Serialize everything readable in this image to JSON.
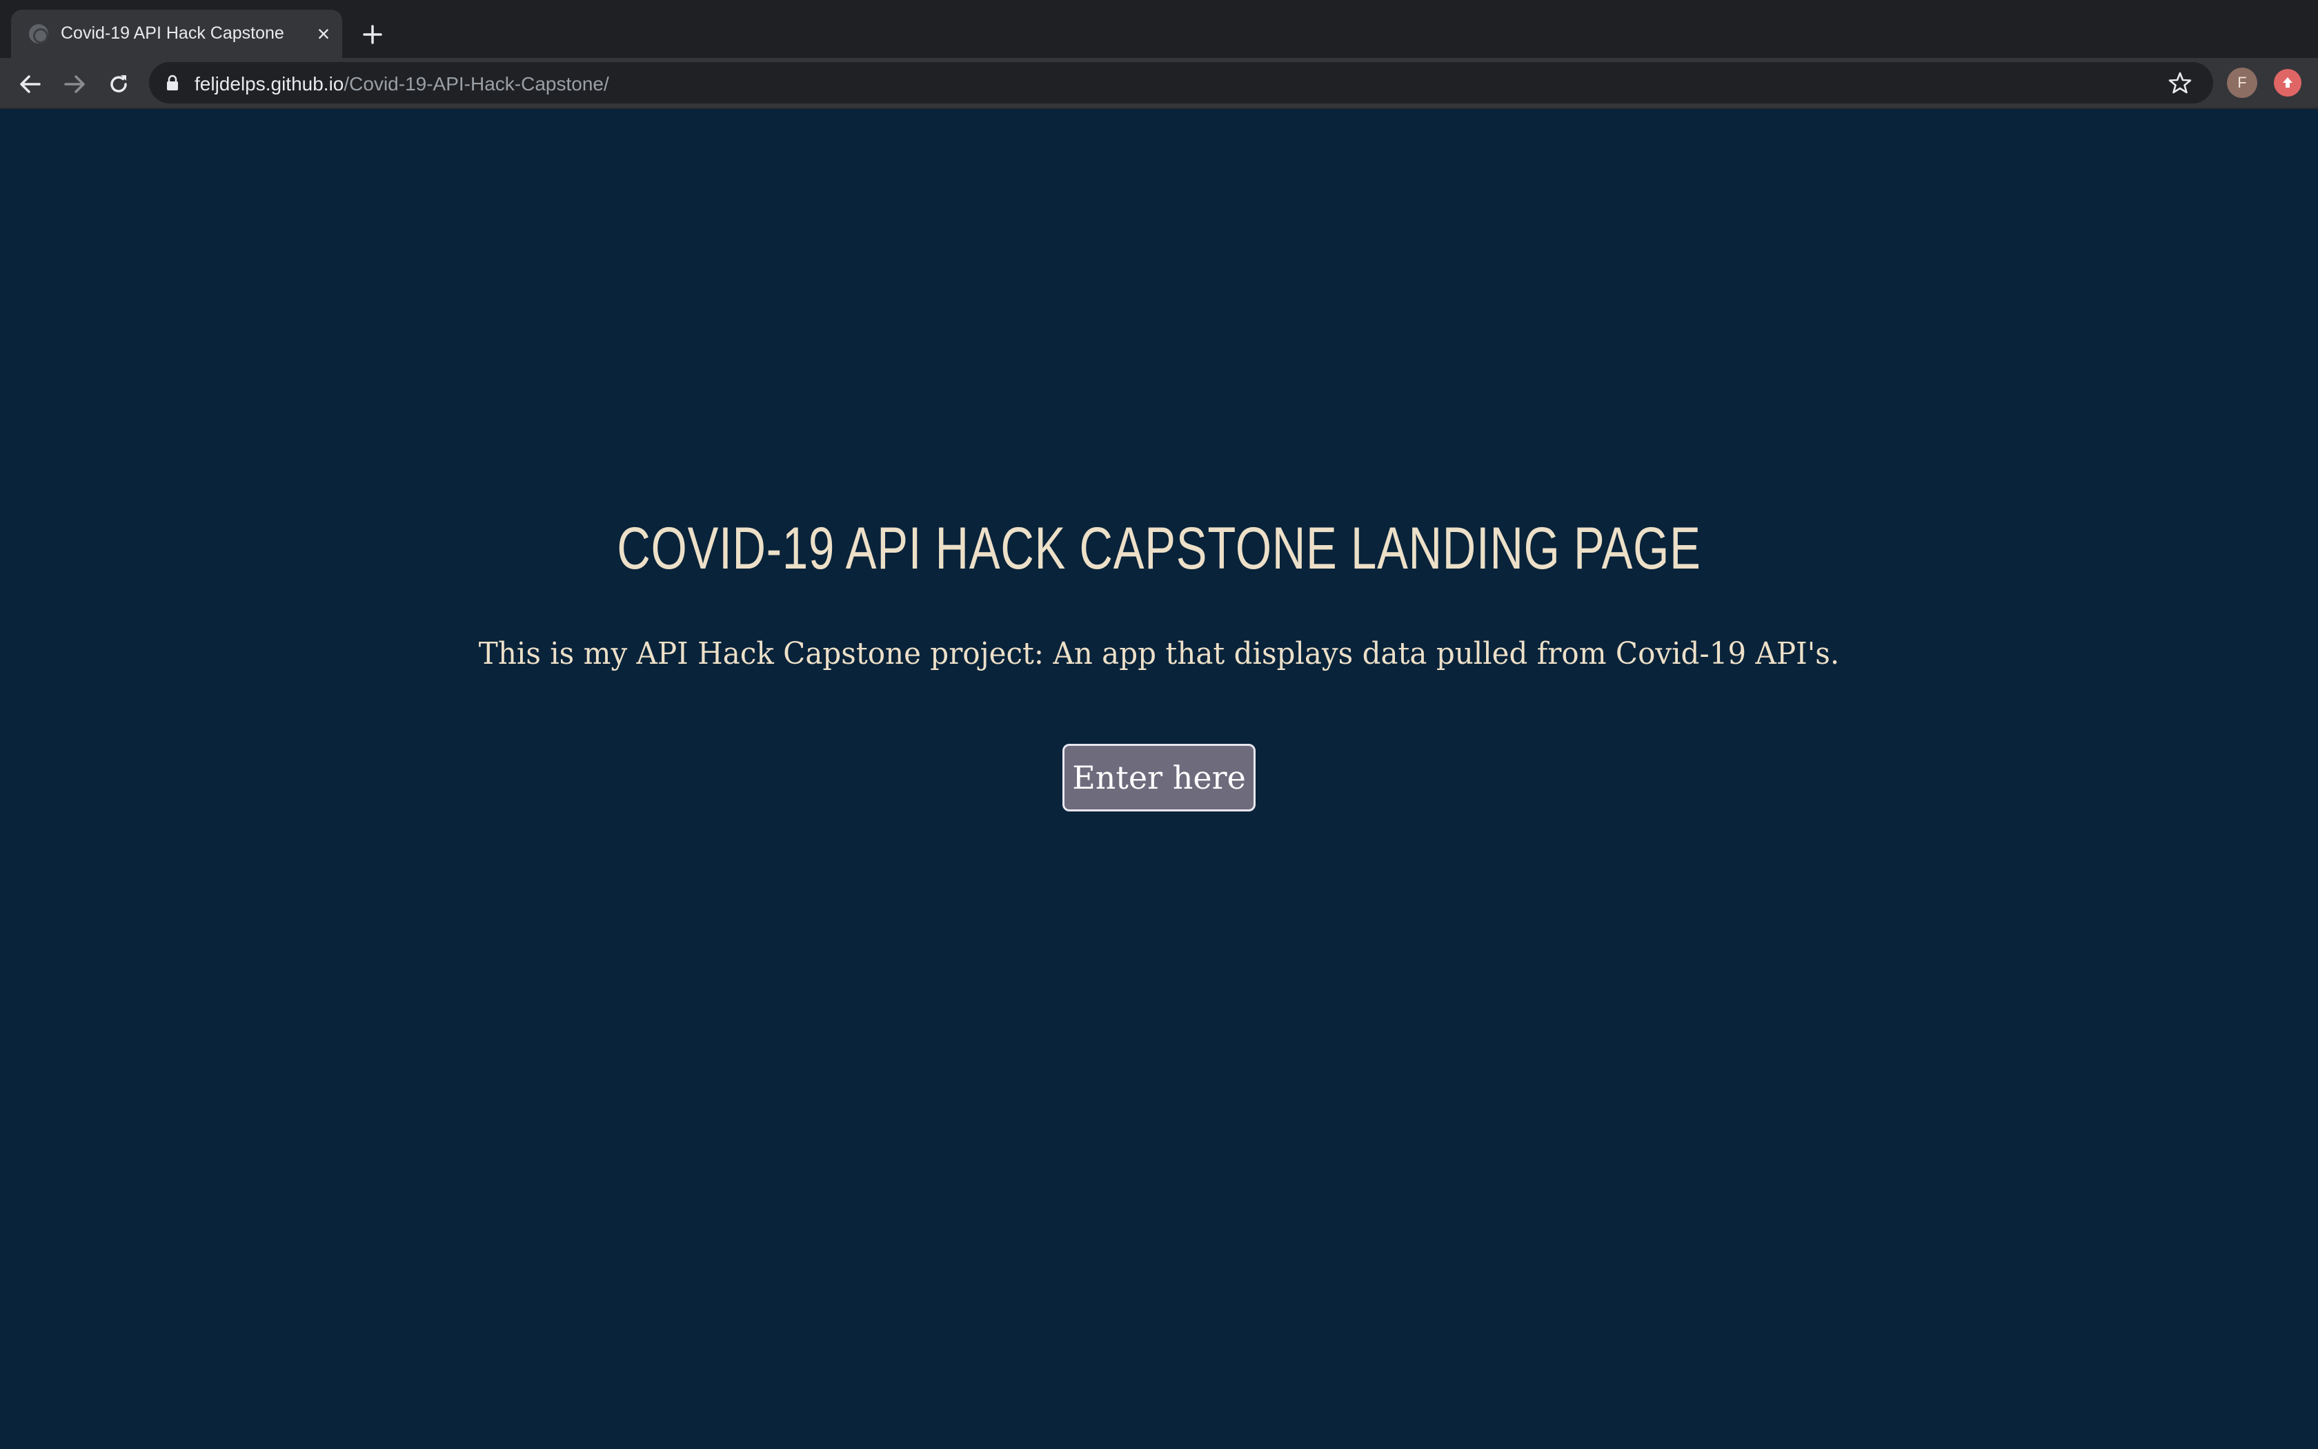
{
  "browser": {
    "tab": {
      "title": "Covid-19 API Hack Capstone",
      "close_icon": "close-icon",
      "favicon": "globe-icon"
    },
    "new_tab_icon": "plus-icon",
    "toolbar": {
      "back_icon": "back-arrow-icon",
      "forward_icon": "forward-arrow-icon",
      "reload_icon": "reload-icon",
      "url_host": "feljdelps.github.io",
      "url_path": "/Covid-19-API-Hack-Capstone/",
      "lock_icon": "lock-icon",
      "bookmark_icon": "star-icon",
      "profile_initial": "F",
      "extension_icon": "extension-icon"
    }
  },
  "page": {
    "title": "COVID-19 API HACK CAPSTONE LANDING PAGE",
    "description": "This is my API Hack Capstone project: An app that displays data pulled from Covid-19 API's.",
    "enter_button": "Enter here"
  },
  "colors": {
    "page_background": "#09233a",
    "text": "#ede0c8",
    "button_background": "#6d6b7c",
    "button_border": "#e8e6ef"
  }
}
